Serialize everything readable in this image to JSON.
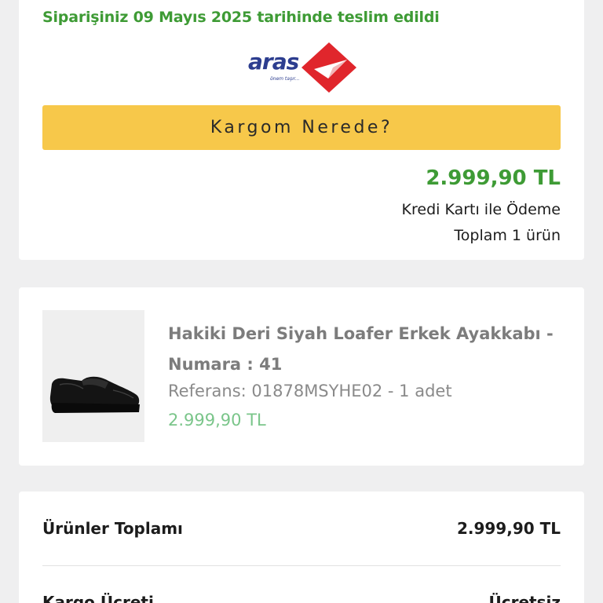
{
  "order": {
    "delivered_text": "Siparişiniz 09 Mayıs 2025 tarihinde teslim edildi",
    "carrier": {
      "name": "aras",
      "slogan": "önem taşır..."
    },
    "track_button": "Kargom Nerede?",
    "amount": "2.999,90 TL",
    "payment_method": "Kredi Kartı ile Ödeme",
    "item_count": "Toplam 1 ürün"
  },
  "product": {
    "image_icon": "black-loafer-shoe",
    "name": "Hakiki Deri Siyah Loafer Erkek Ayakkabı - Numara : 41",
    "reference": "Referans: 01878MSYHE02 - 1 adet",
    "price": "2.999,90 TL"
  },
  "summary": {
    "products_total_label": "Ürünler Toplamı",
    "products_total_value": "2.999,90 TL",
    "shipping_label": "Kargo Ücreti",
    "shipping_value": "Ücretsiz"
  },
  "colors": {
    "accent_green": "#3e9b35",
    "button_yellow": "#f7c84a",
    "aras_red": "#e0262c",
    "aras_blue": "#2c3d8f"
  }
}
